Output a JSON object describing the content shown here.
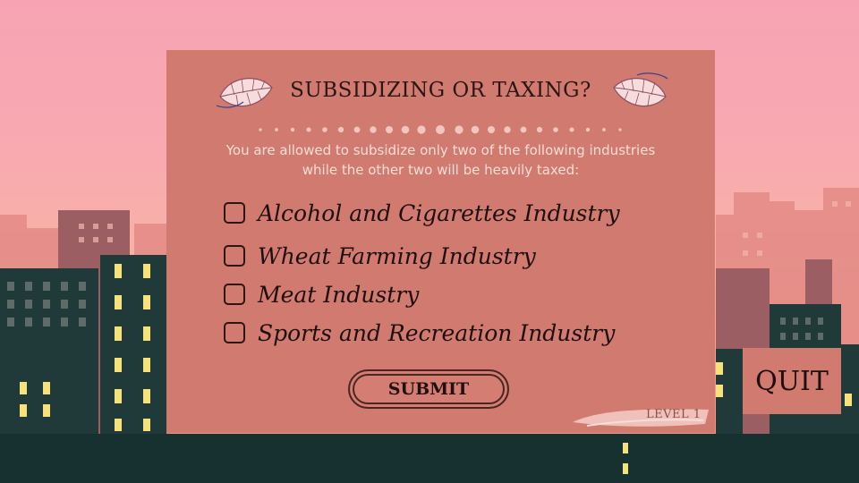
{
  "dialog": {
    "title": "SUBSIDIZING OR TAXING?",
    "instructions": "You are allowed to subsidize only two of the following industries while the other two will be heavily taxed:",
    "options": [
      {
        "label": "Alcohol and Cigarettes Industry",
        "checked": false
      },
      {
        "label": "Wheat Farming Industry",
        "checked": false
      },
      {
        "label": "Meat Industry",
        "checked": false
      },
      {
        "label": "Sports and Recreation Industry",
        "checked": false
      }
    ],
    "submit_label": "SUBMIT",
    "level_label": "LEVEL 1"
  },
  "quit_label": "QUIT",
  "colors": {
    "sky_top": "#f7a3b3",
    "sky_bottom": "#f2a48c",
    "panel": "#d17b70",
    "building_dark": "#1f3a38",
    "window_lit": "#f5e27a"
  }
}
